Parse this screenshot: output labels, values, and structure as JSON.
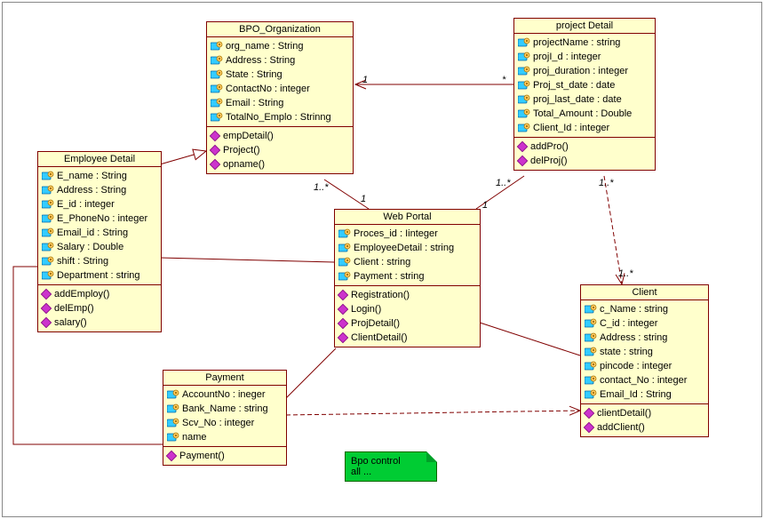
{
  "classes": {
    "bpo": {
      "name": "BPO_Organization",
      "attrs": [
        "org_name : String",
        "Address : String",
        "State : String",
        "ContactNo : integer",
        "Email : String",
        "TotalNo_Emplo : Strinng"
      ],
      "ops": [
        "empDetail()",
        "Project()",
        "opname()"
      ]
    },
    "project": {
      "name": "project Detail",
      "attrs": [
        "projectName : string",
        "projI_d : integer",
        "proj_duration : integer",
        "Proj_st_date : date",
        "proj_last_date : date",
        "Total_Amount : Double",
        "Client_Id : integer"
      ],
      "ops": [
        "addPro()",
        "delProj()"
      ]
    },
    "employee": {
      "name": "Employee Detail",
      "attrs": [
        "E_name : String",
        "Address : String",
        "E_id : integer",
        "E_PhoneNo : integer",
        "Email_id : String",
        "Salary : Double",
        "shift : String",
        "Department : string"
      ],
      "ops": [
        "addEmploy()",
        "delEmp()",
        "salary()"
      ]
    },
    "webportal": {
      "name": "Web Portal",
      "attrs": [
        "Proces_id : Iinteger",
        "EmployeeDetail : string",
        "Client : string",
        "Payment : string"
      ],
      "ops": [
        "Registration()",
        "Login()",
        "ProjDetail()",
        "ClientDetail()"
      ]
    },
    "payment": {
      "name": "Payment",
      "attrs": [
        "AccountNo : ineger",
        "Bank_Name : string",
        "Scv_No : integer",
        "name"
      ],
      "ops": [
        "Payment()"
      ]
    },
    "client": {
      "name": "Client",
      "attrs": [
        "c_Name : string",
        "C_id : integer",
        "Address : string",
        "state : string",
        "pincode : integer",
        "contact_No : integer",
        "Email_Id : String"
      ],
      "ops": [
        "clientDetail()",
        "addClient()"
      ]
    }
  },
  "note": {
    "line1": "Bpo control",
    "line2": "all ..."
  },
  "multiplicities": {
    "m1": "1",
    "m2": "1..*",
    "m3": "*",
    "m4": "1..*",
    "m5": "1..*",
    "m6": "1",
    "m7": "1",
    "m8": "1..*"
  },
  "chart_data": {
    "type": "uml-class-diagram",
    "classes": [
      {
        "id": "bpo",
        "name": "BPO_Organization",
        "attributes": [
          "org_name:String",
          "Address:String",
          "State:String",
          "ContactNo:integer",
          "Email:String",
          "TotalNo_Emplo:Strinng"
        ],
        "operations": [
          "empDetail()",
          "Project()",
          "opname()"
        ]
      },
      {
        "id": "project",
        "name": "project Detail",
        "attributes": [
          "projectName:string",
          "projI_d:integer",
          "proj_duration:integer",
          "Proj_st_date:date",
          "proj_last_date:date",
          "Total_Amount:Double",
          "Client_Id:integer"
        ],
        "operations": [
          "addPro()",
          "delProj()"
        ]
      },
      {
        "id": "employee",
        "name": "Employee Detail",
        "attributes": [
          "E_name:String",
          "Address:String",
          "E_id:integer",
          "E_PhoneNo:integer",
          "Email_id:String",
          "Salary:Double",
          "shift:String",
          "Department:string"
        ],
        "operations": [
          "addEmploy()",
          "delEmp()",
          "salary()"
        ]
      },
      {
        "id": "webportal",
        "name": "Web Portal",
        "attributes": [
          "Proces_id:Iinteger",
          "EmployeeDetail:string",
          "Client:string",
          "Payment:string"
        ],
        "operations": [
          "Registration()",
          "Login()",
          "ProjDetail()",
          "ClientDetail()"
        ]
      },
      {
        "id": "payment",
        "name": "Payment",
        "attributes": [
          "AccountNo:ineger",
          "Bank_Name:string",
          "Scv_No:integer",
          "name"
        ],
        "operations": [
          "Payment()"
        ]
      },
      {
        "id": "client",
        "name": "Client",
        "attributes": [
          "c_Name:string",
          "C_id:integer",
          "Address:string",
          "state:string",
          "pincode:integer",
          "contact_No:integer",
          "Email_Id:String"
        ],
        "operations": [
          "clientDetail()",
          "addClient()"
        ]
      }
    ],
    "relationships": [
      {
        "from": "project",
        "to": "bpo",
        "type": "association-directed",
        "from_mult": "*",
        "to_mult": "1"
      },
      {
        "from": "employee",
        "to": "bpo",
        "type": "generalization"
      },
      {
        "from": "bpo",
        "to": "webportal",
        "type": "association",
        "from_mult": "1..*",
        "to_mult": "1"
      },
      {
        "from": "project",
        "to": "webportal",
        "type": "association",
        "from_mult": "1..*",
        "to_mult": "1"
      },
      {
        "from": "employee",
        "to": "webportal",
        "type": "association"
      },
      {
        "from": "payment",
        "to": "webportal",
        "type": "association"
      },
      {
        "from": "client",
        "to": "webportal",
        "type": "association"
      },
      {
        "from": "project",
        "to": "client",
        "type": "dependency",
        "from_mult": "1..*",
        "to_mult": "1..*"
      },
      {
        "from": "payment",
        "to": "client",
        "type": "dependency"
      },
      {
        "from": "payment",
        "to": "employee",
        "type": "association"
      }
    ],
    "note": {
      "text": "Bpo control all ...",
      "attached_to": "webportal"
    }
  }
}
